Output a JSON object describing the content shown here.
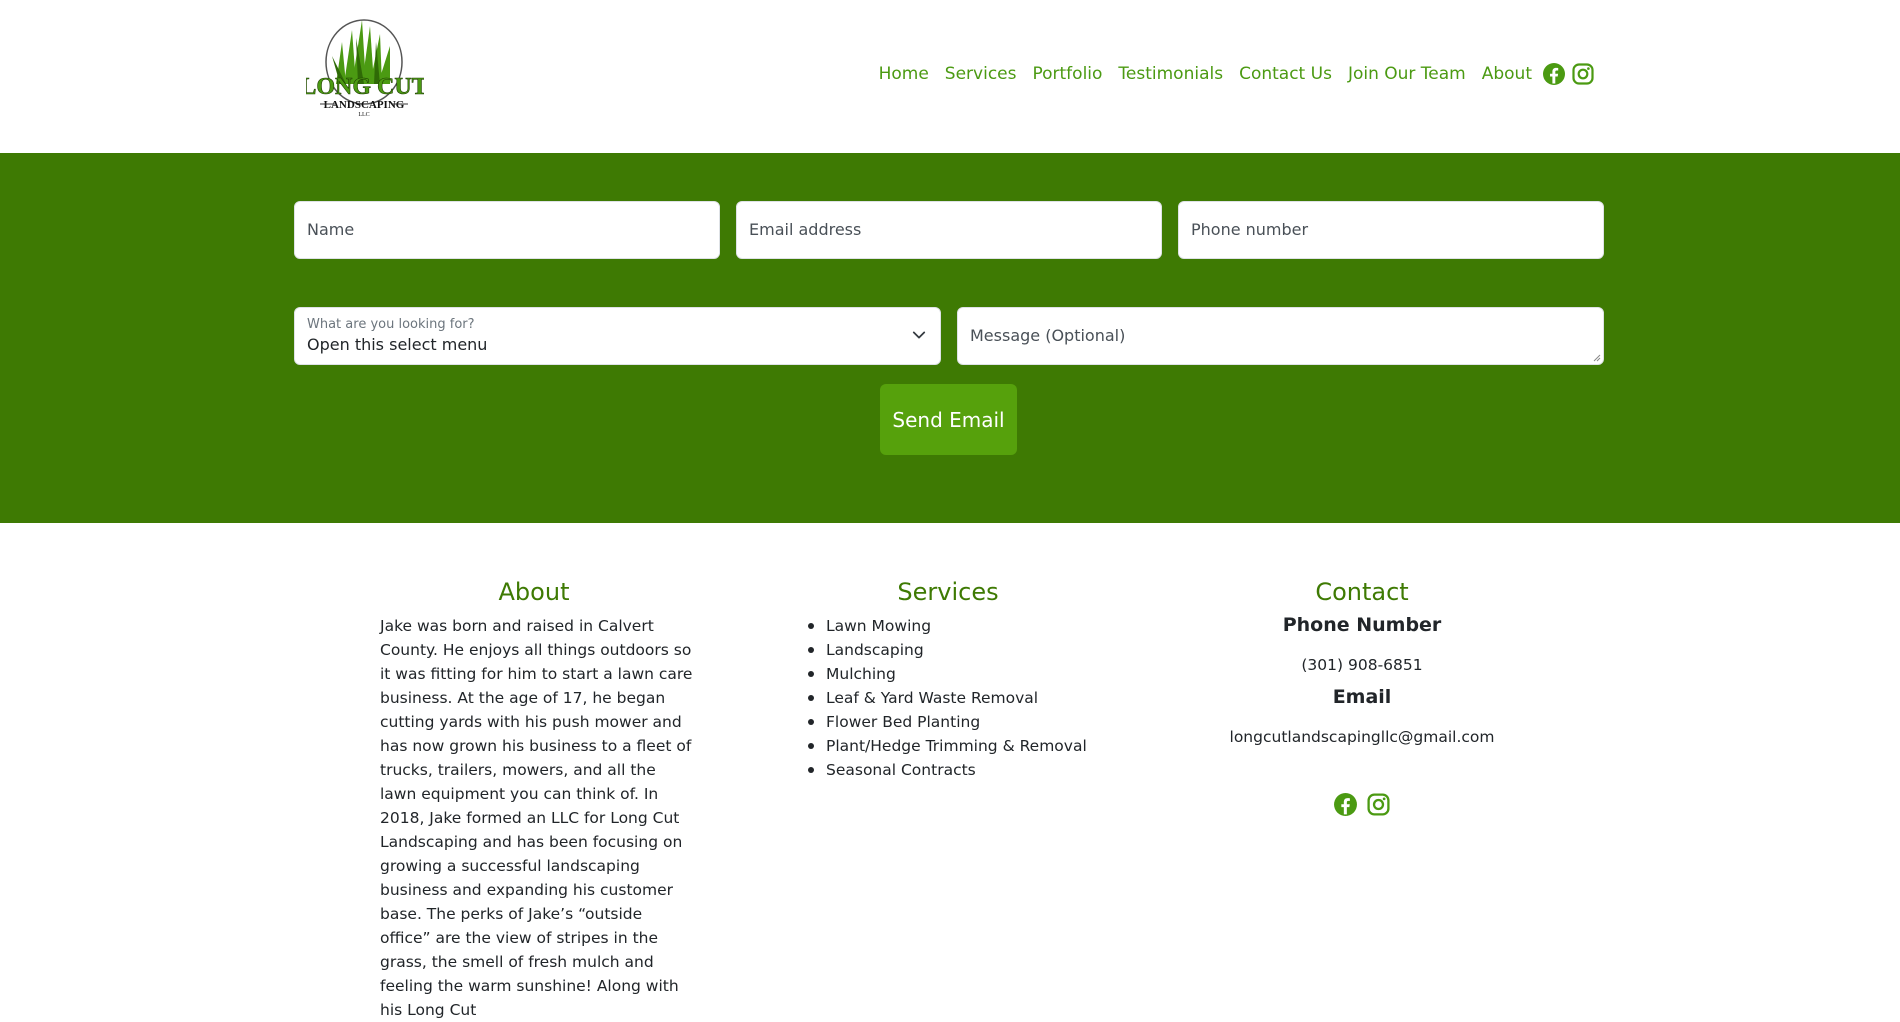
{
  "brand": {
    "logo_line1": "LONG CUT",
    "logo_line2": "LANDSCAPING",
    "logo_line3": "LLC",
    "accent": "#4b9a12",
    "band_color": "#3e7a03"
  },
  "nav": {
    "items": [
      "Home",
      "Services",
      "Portfolio",
      "Testimonials",
      "Contact Us",
      "Join Our Team",
      "About"
    ],
    "social_icons": [
      "facebook-icon",
      "instagram-icon"
    ]
  },
  "form": {
    "name_placeholder": "Name",
    "email_placeholder": "Email address",
    "phone_placeholder": "Phone number",
    "select_label": "What are you looking for?",
    "select_value": "Open this select menu",
    "message_placeholder": "Message (Optional)",
    "submit_label": "Send Email"
  },
  "footer": {
    "about_title": "About",
    "about_text": "Jake was born and raised in Calvert County. He enjoys all things outdoors so it was fitting for him to start a lawn care business. At the age of 17, he began cutting yards with his push mower and has now grown his business to a fleet of trucks, trailers, mowers, and all the lawn equipment you can think of. In 2018, Jake formed an LLC for Long Cut Landscaping and has been focusing on growing a successful landscaping business and expanding his customer base. The perks of Jake’s “outside office” are the view of stripes in the grass, the smell of fresh mulch and feeling the warm sunshine! Along with his Long Cut",
    "services_title": "Services",
    "services": [
      "Lawn Mowing",
      "Landscaping",
      "Mulching",
      "Leaf & Yard Waste Removal",
      "Flower Bed Planting",
      "Plant/Hedge Trimming & Removal",
      "Seasonal Contracts"
    ],
    "contact_title": "Contact",
    "phone_heading": "Phone Number",
    "phone": "(301) 908-6851",
    "email_heading": "Email",
    "email": "longcutlandscapingllc@gmail.com"
  }
}
